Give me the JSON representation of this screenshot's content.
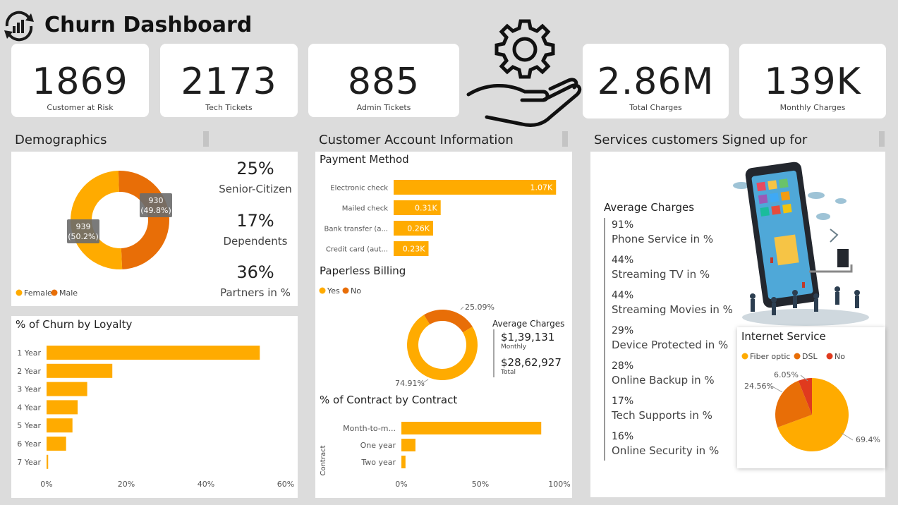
{
  "header": {
    "title": "Churn Dashboard",
    "logo_icon": "churn-cycle-icon",
    "center_icon": "gear-hand-icon"
  },
  "colors": {
    "accent": "#FFAB00",
    "secondary": "#E86E07",
    "red": "#E03A1E",
    "background": "#dcdcdc",
    "card": "#ffffff"
  },
  "kpis": [
    {
      "value": "1869",
      "label": "Customer at Risk"
    },
    {
      "value": "2173",
      "label": "Tech Tickets"
    },
    {
      "value": "885",
      "label": "Admin Tickets"
    },
    {
      "value": "2.86M",
      "label": "Total Charges"
    },
    {
      "value": "139K",
      "label": "Monthly Charges"
    }
  ],
  "sections": {
    "demographics": "Demographics",
    "account": "Customer Account Information",
    "services": "Services customers Signed up for"
  },
  "demographics": {
    "stats": [
      {
        "value": "25%",
        "label": "Senior-Citizen"
      },
      {
        "value": "17%",
        "label": "Dependents"
      },
      {
        "value": "36%",
        "label": "Partners in %"
      }
    ],
    "legend": [
      "Female",
      "Male"
    ],
    "donut_labels": {
      "female_count": "939",
      "female_pct": "(50.2%)",
      "male_count": "930",
      "male_pct": "(49.8%)"
    }
  },
  "loyalty_title": "% of Churn by Loyalty",
  "payment_title": "Payment Method",
  "paperless": {
    "title": "Paperless Billing",
    "legend": [
      "Yes",
      "No"
    ],
    "pct_no": "25.09%",
    "pct_yes": "74.91%",
    "avg_title": "Average Charges",
    "monthly_value": "$1,39,131",
    "monthly_label": "Monthly",
    "total_value": "$28,62,927",
    "total_label": "Total"
  },
  "contract_title": "% of Contract by Contract",
  "services": {
    "avg_title": "Average Charges",
    "items": [
      {
        "pct": "91%",
        "label": "Phone Service in %"
      },
      {
        "pct": "44%",
        "label": "Streaming TV in %"
      },
      {
        "pct": "44%",
        "label": "Streaming Movies in %"
      },
      {
        "pct": "29%",
        "label": "Device Protected in %"
      },
      {
        "pct": "28%",
        "label": "Online Backup in %"
      },
      {
        "pct": "17%",
        "label": "Tech Supports in %"
      },
      {
        "pct": "16%",
        "label": "Online Security in %"
      }
    ],
    "illustration": "tablet-people-illustration"
  },
  "chart_data": [
    {
      "type": "pie",
      "title": "",
      "categories": [
        "Female",
        "Male"
      ],
      "values": [
        939,
        930
      ],
      "percents": [
        50.2,
        49.8
      ]
    },
    {
      "type": "bar",
      "title": "% of Churn by Loyalty",
      "orientation": "horizontal",
      "categories": [
        "1 Year",
        "2 Year",
        "3 Year",
        "4 Year",
        "5 Year",
        "6 Year",
        "7 Year"
      ],
      "values": [
        53.5,
        16.5,
        10.2,
        7.8,
        6.5,
        4.9,
        0.4
      ],
      "xlim": [
        0,
        60
      ],
      "xticks": [
        "0%",
        "20%",
        "40%",
        "60%"
      ]
    },
    {
      "type": "bar",
      "title": "Payment Method",
      "orientation": "horizontal",
      "categories": [
        "Electronic check",
        "Mailed check",
        "Bank transfer (a...",
        "Credit card (aut..."
      ],
      "values": [
        1070,
        310,
        260,
        230
      ],
      "value_labels": [
        "1.07K",
        "0.31K",
        "0.26K",
        "0.23K"
      ],
      "xlim": [
        0,
        1120
      ]
    },
    {
      "type": "pie",
      "title": "Paperless Billing",
      "categories": [
        "Yes",
        "No"
      ],
      "values": [
        74.91,
        25.09
      ]
    },
    {
      "type": "bar",
      "title": "% of Contract by Contract",
      "orientation": "horizontal",
      "ylabel": "Contract",
      "categories": [
        "Month-to-m...",
        "One year",
        "Two year"
      ],
      "values": [
        88.5,
        8.9,
        2.6
      ],
      "xlim": [
        0,
        100
      ],
      "xticks": [
        "0%",
        "50%",
        "100%"
      ]
    },
    {
      "type": "pie",
      "title": "Internet Service",
      "categories": [
        "Fiber optic",
        "DSL",
        "No"
      ],
      "values": [
        69.4,
        24.56,
        6.05
      ],
      "value_labels": [
        "69.4%",
        "24.56%",
        "6.05%"
      ]
    }
  ]
}
